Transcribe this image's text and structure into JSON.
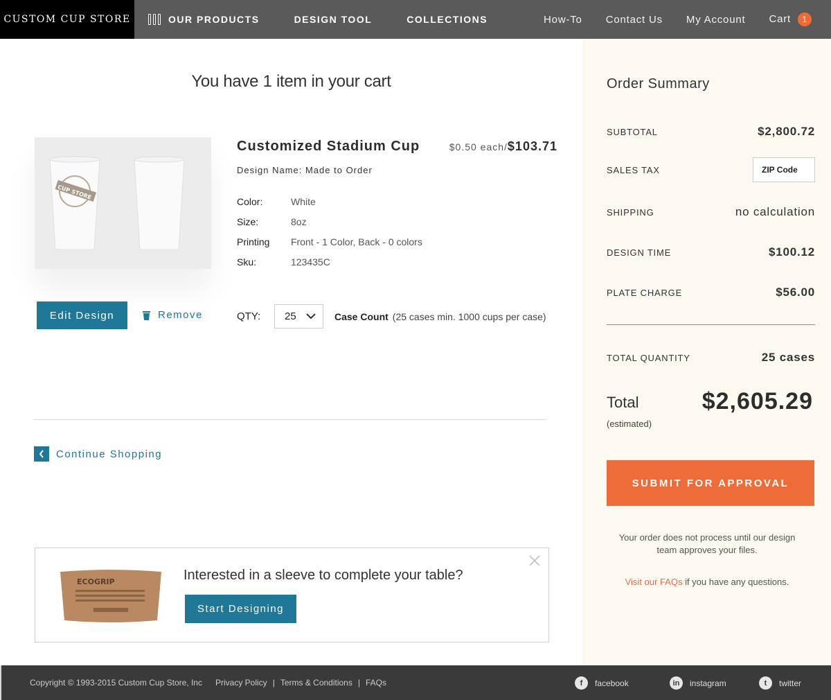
{
  "header": {
    "brand": "CUSTOM CUP STORE",
    "nav_main": [
      "OUR PRODUCTS",
      "DESIGN TOOL",
      "COLLECTIONS"
    ],
    "nav_right": [
      "How-To",
      "Contact Us",
      "My Account",
      "Cart"
    ],
    "cart_count": "1"
  },
  "cart": {
    "title": "You have 1 item in your cart",
    "item": {
      "name": "Customized Stadium Cup",
      "price_each": "$0.50 each/",
      "price_total": "$103.71",
      "design_name": "Design Name: Made to Order",
      "specs": [
        {
          "label": "Color:",
          "value": "White"
        },
        {
          "label": "Size:",
          "value": "8oz"
        },
        {
          "label": "Printing",
          "value": "Front - 1 Color, Back - 0 colors"
        },
        {
          "label": "Sku:",
          "value": "123435C"
        }
      ],
      "cup_logo": "CUP STORE",
      "edit_label": "Edit Design",
      "remove_label": "Remove",
      "qty_label": "QTY:",
      "qty_value": "25",
      "case_count_label": "Case Count",
      "case_count_note": "(25 cases min. 1000 cups per case)"
    },
    "continue_label": "Continue Shopping"
  },
  "promo": {
    "title": "Interested in a sleeve to complete your table?",
    "button": "Start Designing",
    "sleeve_brand": "ECOGRIP"
  },
  "summary": {
    "title": "Order Summary",
    "rows": {
      "subtotal": {
        "label": "SUBTOTAL",
        "value": "$2,800.72"
      },
      "sales_tax": {
        "label": "SALES TAX",
        "placeholder": "ZIP Code"
      },
      "shipping": {
        "label": "SHIPPING",
        "value": "no calculation"
      },
      "design_time": {
        "label": "DESIGN TIME",
        "value": "$100.12"
      },
      "plate_charge": {
        "label": "PLATE CHARGE",
        "value": "$56.00"
      },
      "total_quantity": {
        "label": "TOTAL QUANTITY",
        "value": "25 cases"
      }
    },
    "total_label": "Total",
    "total_sub": "(estimated)",
    "total_value": "$2,605.29",
    "submit": "SUBMIT FOR APPROVAL",
    "note": "Your order does not process until our design team approves your files.",
    "faq_link": "Visit our FAQs",
    "faq_rest": " if you have any questions."
  },
  "footer": {
    "copyright": "Copyright © 1993-2015 Custom Cup Store, Inc",
    "links": [
      "Privacy Policy",
      "Terms & Conditions",
      "FAQs"
    ],
    "social": [
      "facebook",
      "instagram",
      "twitter"
    ]
  },
  "colors": {
    "accent_blue": "#1f7897",
    "accent_orange": "#ee6b3a",
    "sidebar_bg": "#fcf9f1"
  }
}
